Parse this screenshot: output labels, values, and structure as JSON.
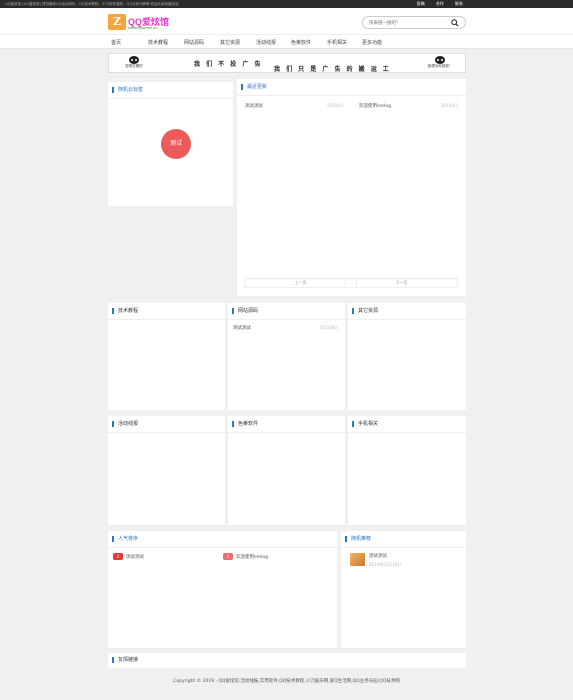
{
  "topbar": {
    "notice": "QQ爱炫馆 (QQ爱炫馆) 提供最新QQ活动资讯，QQ技术教程，小刀软件福利，QQ业务代刷等 欢迎大家收藏本站",
    "links": [
      "投稿",
      "合作",
      "联系"
    ]
  },
  "header": {
    "logo_mark": "Z",
    "logo_text": "QQ爱炫馆",
    "logo_sub": "www.aaiwmm.cn",
    "search_placeholder": "快来搜一搜吧！"
  },
  "nav": [
    "首页",
    "技术教程",
    "网站源码",
    "其它资源",
    "活动线报",
    "色莱软件",
    "手机相关",
    "更多功能"
  ],
  "banner": {
    "left_caption": "您现在看的",
    "right_caption": "我想为你效劳！",
    "line1": "我 们 不 投 广 告",
    "line2": "我 们 只 是 广 告 的 搬 运 工"
  },
  "tag_cloud": {
    "title": "随机云标签",
    "tag": "测试"
  },
  "latest": {
    "title": "最近更新",
    "items": [
      {
        "title": "测试测试",
        "date": "2019/03"
      },
      {
        "title": "欢迎使用emlog",
        "date": "2019/03"
      }
    ],
    "prev": "上一页",
    "next": "下一页"
  },
  "categories": [
    {
      "title": "技术教程",
      "items": []
    },
    {
      "title": "网站源码",
      "items": [
        {
          "title": "测试测试",
          "date": "02月28日"
        }
      ]
    },
    {
      "title": "其它资源",
      "items": []
    },
    {
      "title": "活动线报",
      "items": []
    },
    {
      "title": "色莱软件",
      "items": []
    },
    {
      "title": "手机相关",
      "items": []
    }
  ],
  "popular": {
    "title": "人气排序",
    "items": [
      {
        "rank": "1",
        "title": "测试测试",
        "color": "#e53935"
      },
      {
        "rank": "2",
        "title": "欢迎使用emlog",
        "color": "#ef6c6c"
      }
    ]
  },
  "random": {
    "title": "随机推荐",
    "item_title": "测试测试",
    "item_date": "2019年02月28日"
  },
  "friends": {
    "title": "友情链接"
  },
  "footer": {
    "text": "Copyright © 2019 · QQ爱炫馆·活动线报,实用软件,QQ技术教程,小刀娱乐网,爱Q生活网,QQ业务乐园,QQ技术网"
  }
}
